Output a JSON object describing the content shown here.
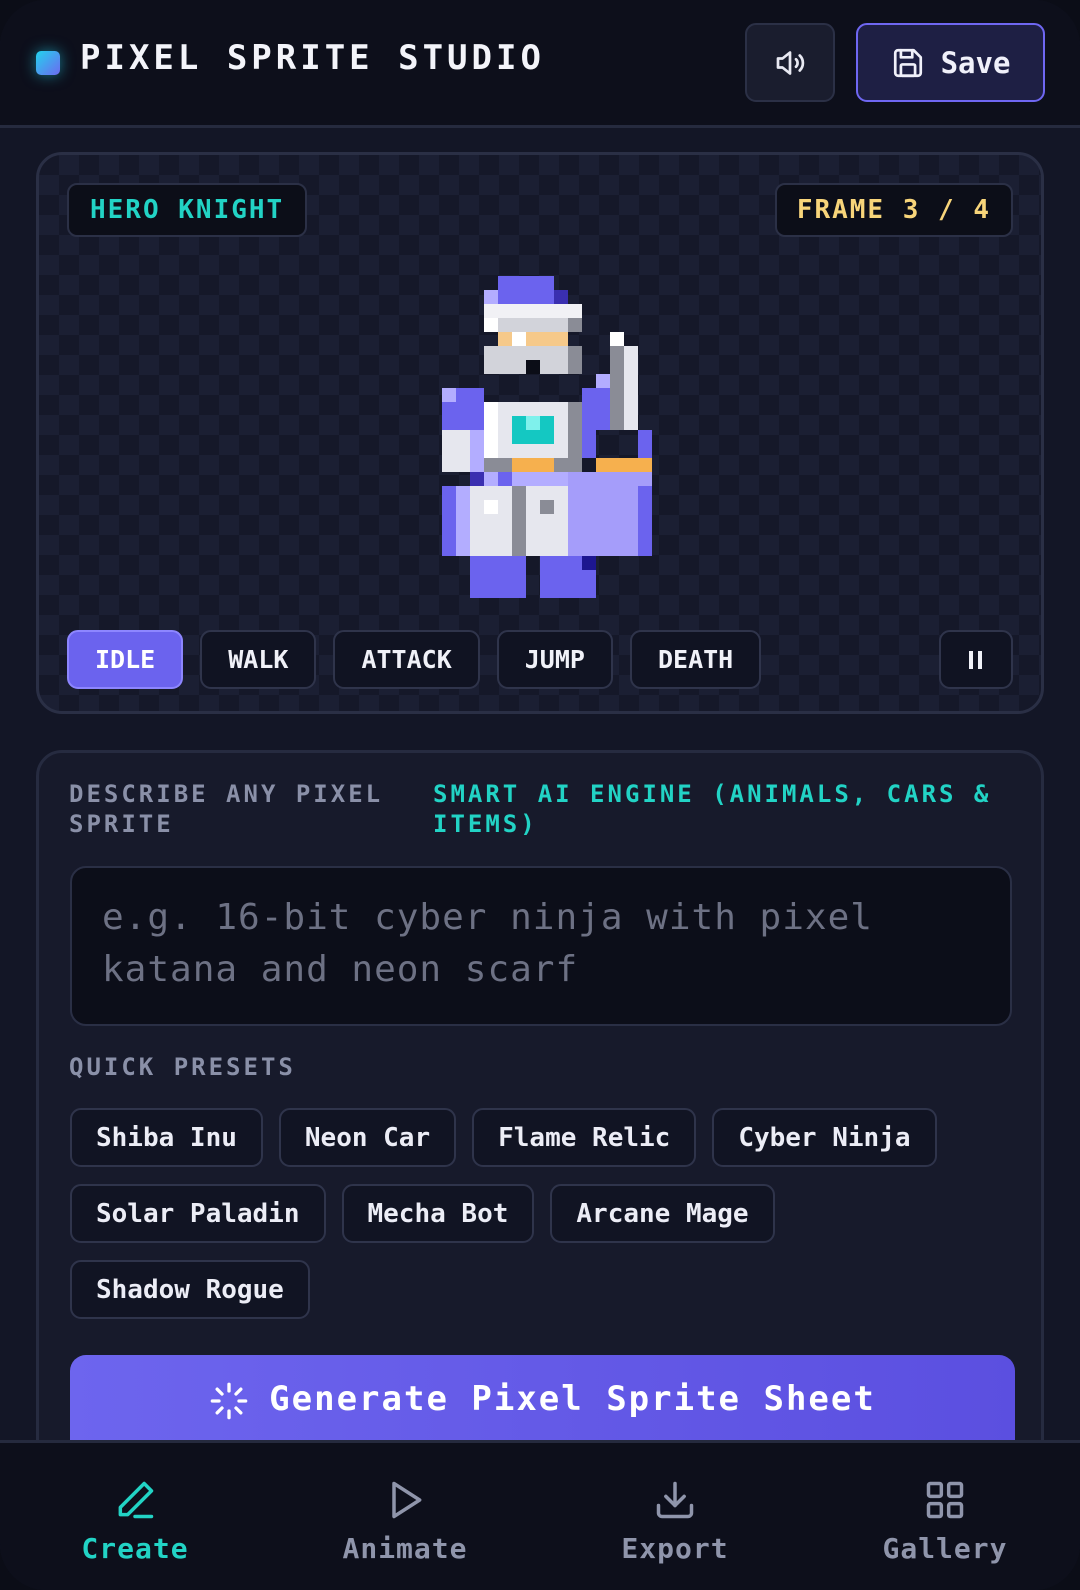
{
  "header": {
    "title": "PIXEL SPRITE STUDIO",
    "sound_icon": "speaker-icon",
    "save_label": "Save",
    "save_icon": "floppy-disk-icon"
  },
  "preview": {
    "character_name": "HERO KNIGHT",
    "frame_text": "FRAME 3 / 4",
    "current_frame": 3,
    "total_frames": 4,
    "animations": [
      {
        "label": "IDLE",
        "active": true
      },
      {
        "label": "WALK",
        "active": false
      },
      {
        "label": "ATTACK",
        "active": false
      },
      {
        "label": "JUMP",
        "active": false
      },
      {
        "label": "DEATH",
        "active": false
      }
    ],
    "pause_icon": "pause-icon"
  },
  "describe": {
    "label": "DESCRIBE ANY PIXEL SPRITE",
    "hint": "SMART AI ENGINE (ANIMALS, CARS & ITEMS)",
    "prompt_value": "",
    "prompt_placeholder": "e.g. 16-bit cyber ninja with pixel katana and neon scarf",
    "presets_title": "QUICK PRESETS",
    "presets": [
      "Shiba Inu",
      "Neon Car",
      "Flame Relic",
      "Cyber Ninja",
      "Solar Paladin",
      "Mecha Bot",
      "Arcane Mage",
      "Shadow Rogue"
    ],
    "generate_label": "Generate Pixel Sprite Sheet",
    "generate_icon": "loader-icon"
  },
  "nav": [
    {
      "label": "Create",
      "icon": "pencil-icon",
      "active": true
    },
    {
      "label": "Animate",
      "icon": "play-icon",
      "active": false
    },
    {
      "label": "Export",
      "icon": "download-icon",
      "active": false
    },
    {
      "label": "Gallery",
      "icon": "grid-icon",
      "active": false
    }
  ],
  "colors": {
    "accent": "#6b63ee",
    "teal": "#22d3c5",
    "gold": "#f8d57a",
    "background": "#131626"
  }
}
